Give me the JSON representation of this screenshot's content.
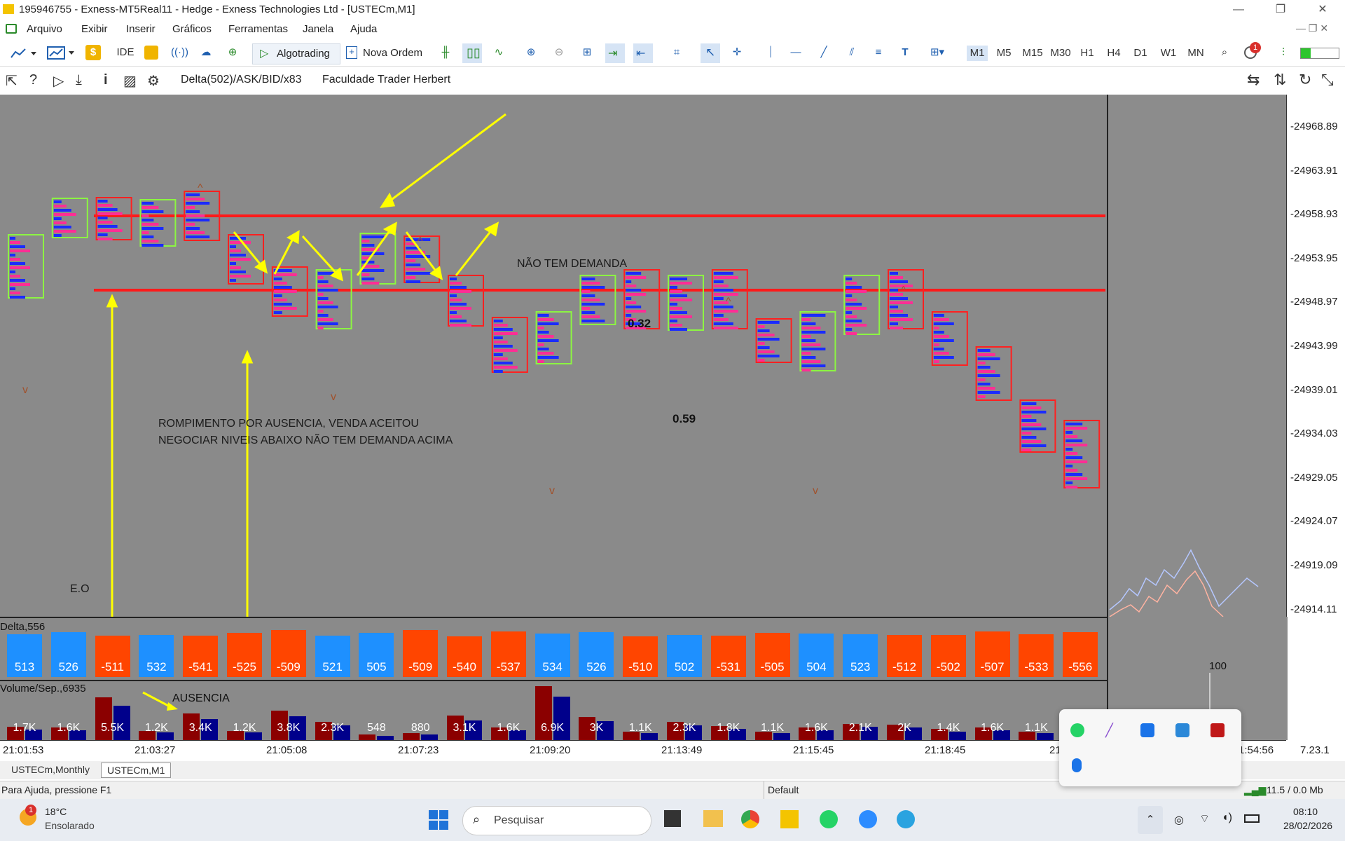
{
  "window": {
    "title": "195946755 - Exness-MT5Real11 - Hedge - Exness Technologies Ltd - [USTECm,M1]",
    "controls": [
      "—",
      "❐",
      "✕"
    ]
  },
  "menu": {
    "items": [
      "Arquivo",
      "Exibir",
      "Inserir",
      "Gráficos",
      "Ferramentas",
      "Janela",
      "Ajuda"
    ]
  },
  "toolbar": {
    "ide_label": "IDE",
    "algotrading_label": "Algotrading",
    "nova_ordem_label": "Nova Ordem",
    "timeframes": [
      "M1",
      "M5",
      "M15",
      "M30",
      "H1",
      "H4",
      "D1",
      "W1",
      "MN"
    ],
    "active_timeframe": "M1",
    "notification_count": "1"
  },
  "chartbar": {
    "indicator_text": "Delta(502)/ASK/BID/x83",
    "author_text": "Faculdade Trader Herbert"
  },
  "price_axis": [
    "24968.89",
    "24963.91",
    "24958.93",
    "24953.95",
    "24948.97",
    "24943.99",
    "24939.01",
    "24934.03",
    "24929.05",
    "24924.07",
    "24919.09",
    "24914.11"
  ],
  "annotations": {
    "no_demand": "NÃO TEM DEMANDA",
    "breakout_line1": "ROMPIMENTO POR AUSENCIA, VENDA ACEITOU",
    "breakout_line2": "NEGOCIAR NIVEIS ABAIXO NÃO TEM DEMANDA ACIMA",
    "eo": "E.O",
    "val_032": "0.32",
    "val_059": "0.59",
    "ausencia": "AUSENCIA"
  },
  "delta_panel": {
    "title": "Delta,556",
    "values": [
      "513",
      "526",
      "-511",
      "532",
      "-541",
      "-525",
      "-509",
      "521",
      "505",
      "-509",
      "-540",
      "-537",
      "534",
      "526",
      "-510",
      "502",
      "-531",
      "-505",
      "504",
      "523",
      "-512",
      "-502",
      "-507",
      "-533",
      "-556"
    ]
  },
  "volume_panel": {
    "title": "Volume/Sep.,6935",
    "values": [
      "1.7K",
      "1.6K",
      "5.5K",
      "1.2K",
      "3.4K",
      "1.2K",
      "3.8K",
      "2.3K",
      "548",
      "880",
      "3.1K",
      "1.6K",
      "6.9K",
      "3K",
      "1.1K",
      "2.3K",
      "1.8K",
      "1.1K",
      "1.6K",
      "2.1K",
      "2K",
      "1.4K",
      "1.6K",
      "1.1K"
    ],
    "right_label": "100"
  },
  "time_axis": {
    "labels": [
      "21:01:53",
      "21:03:27",
      "21:05:08",
      "21:07:23",
      "21:09:20",
      "21:13:49",
      "21:15:45",
      "21:18:45",
      "21",
      "1:54:56"
    ],
    "right_value": "7.23.1"
  },
  "tabs": [
    "USTECm,Monthly",
    "USTECm,M1"
  ],
  "active_tab": "USTECm,M1",
  "status": {
    "help": "Para Ajuda, pressione F1",
    "profile": "Default",
    "network": "11.5 / 0.0 Mb"
  },
  "taskbar": {
    "weather_temp": "18°C",
    "weather_desc": "Ensolarado",
    "weather_badge": "1",
    "search_placeholder": "Pesquisar",
    "time": "08:10",
    "date": "28/02/2026"
  },
  "colors": {
    "chart_bg": "#8a8a8a",
    "bull_delta": "#1e90ff",
    "bear_delta": "#ff4500",
    "level_line": "#ff0000",
    "arrow": "#ffff00"
  }
}
